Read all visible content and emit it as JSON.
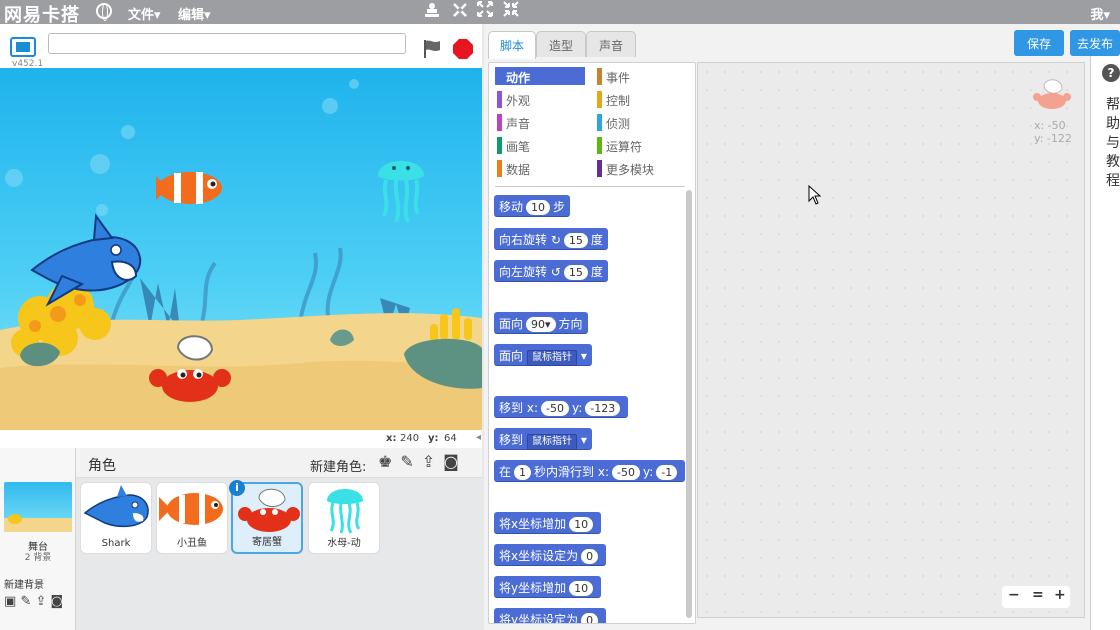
{
  "menubar": {
    "logo": "网易卡搭",
    "file_menu": "文件▾",
    "edit_menu": "编辑▾",
    "user": "我▾"
  },
  "stage": {
    "version": "v452.1",
    "title_value": "",
    "x_label": "x:",
    "x_value": "240",
    "y_label": "y:",
    "y_value": "64"
  },
  "sprites": {
    "header": "角色",
    "new_sprite_label": "新建角色:",
    "stage_label": "舞台",
    "stage_backdrops": "2 背景",
    "new_backdrop_label": "新建背景",
    "items": [
      {
        "name": "Shark"
      },
      {
        "name": "小丑鱼"
      },
      {
        "name": "寄居蟹"
      },
      {
        "name": "水母-动"
      }
    ]
  },
  "tabs": [
    "脚本",
    "造型",
    "声音"
  ],
  "buttons": {
    "save": "保存",
    "publish": "去发布"
  },
  "categories": [
    {
      "label": "动作",
      "color": "#4a6cd4"
    },
    {
      "label": "事件",
      "color": "#c88330"
    },
    {
      "label": "外观",
      "color": "#8a55d7"
    },
    {
      "label": "控制",
      "color": "#e1a91a"
    },
    {
      "label": "声音",
      "color": "#bb42c3"
    },
    {
      "label": "侦测",
      "color": "#2ca5e2"
    },
    {
      "label": "画笔",
      "color": "#0e9a6c"
    },
    {
      "label": "运算符",
      "color": "#5cb712"
    },
    {
      "label": "数据",
      "color": "#ee7d16"
    },
    {
      "label": "更多模块",
      "color": "#632d99"
    }
  ],
  "blocks": {
    "move": {
      "pre": "移动",
      "val": "10",
      "post": "步"
    },
    "turn_right": {
      "pre": "向右旋转",
      "icon": "↻",
      "val": "15",
      "post": "度"
    },
    "turn_left": {
      "pre": "向左旋转",
      "icon": "↺",
      "val": "15",
      "post": "度"
    },
    "point_dir": {
      "pre": "面向",
      "val": "90▾",
      "post": "方向"
    },
    "point_towards": {
      "pre": "面向",
      "dd": "鼠标指针"
    },
    "goto_xy": {
      "pre": "移到",
      "xl": "x:",
      "x": "-50",
      "yl": "y:",
      "y": "-123"
    },
    "goto": {
      "pre": "移到",
      "dd": "鼠标指针"
    },
    "glide": {
      "pre": "在",
      "val": "1",
      "mid": "秒内滑行到",
      "xl": "x:",
      "x": "-50",
      "yl": "y:",
      "y": "-1"
    },
    "change_x": {
      "pre": "将x坐标增加",
      "val": "10"
    },
    "set_x": {
      "pre": "将x坐标设定为",
      "val": "0"
    },
    "change_y": {
      "pre": "将y坐标增加",
      "val": "10"
    },
    "set_y": {
      "pre": "将y坐标设定为",
      "val": "0"
    }
  },
  "script_area": {
    "sprite_x": "x: -50",
    "sprite_y": "y: -122"
  },
  "zoom": {
    "out": "−",
    "reset": "=",
    "in": "+"
  },
  "help": {
    "q": "?",
    "text": "帮助与教程"
  }
}
